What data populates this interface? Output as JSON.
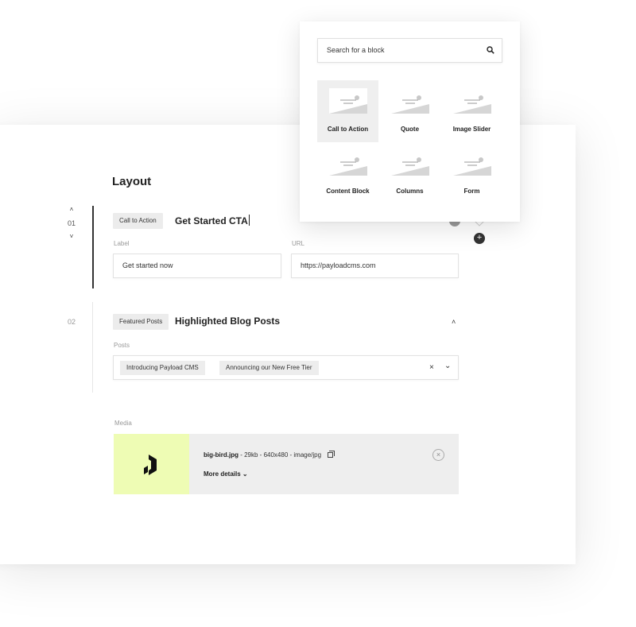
{
  "layout": {
    "title": "Layout"
  },
  "rows": [
    {
      "index": "01",
      "block_type": "Call to Action",
      "title": "Get Started CTA",
      "fields": {
        "label": {
          "label": "Label",
          "value": "Get started now"
        },
        "url": {
          "label": "URL",
          "value": "https://payloadcms.com"
        }
      }
    },
    {
      "index": "02",
      "block_type": "Featured Posts",
      "title": "Highlighted Blog Posts",
      "posts": {
        "label": "Posts",
        "selected": [
          "Introducing Payload CMS",
          "Announcing our New Free Tier"
        ],
        "clear_icon": "×",
        "dropdown_icon": "⌄"
      }
    }
  ],
  "media": {
    "label": "Media",
    "filename": "big-bird.jpg",
    "meta": " - 29kb - 640x480 - image/jpg",
    "more_details": "More details ⌄",
    "remove_icon": "×",
    "thumb_color": "#eefcb4"
  },
  "block_drawer": {
    "search_placeholder": "Search for a block",
    "blocks": [
      "Call to Action",
      "Quote",
      "Image Slider",
      "Content Block",
      "Columns",
      "Form"
    ],
    "active_block": "Call to Action"
  },
  "icons": {
    "up": "˄",
    "down": "˅",
    "collapse": "˄",
    "add": "+"
  }
}
